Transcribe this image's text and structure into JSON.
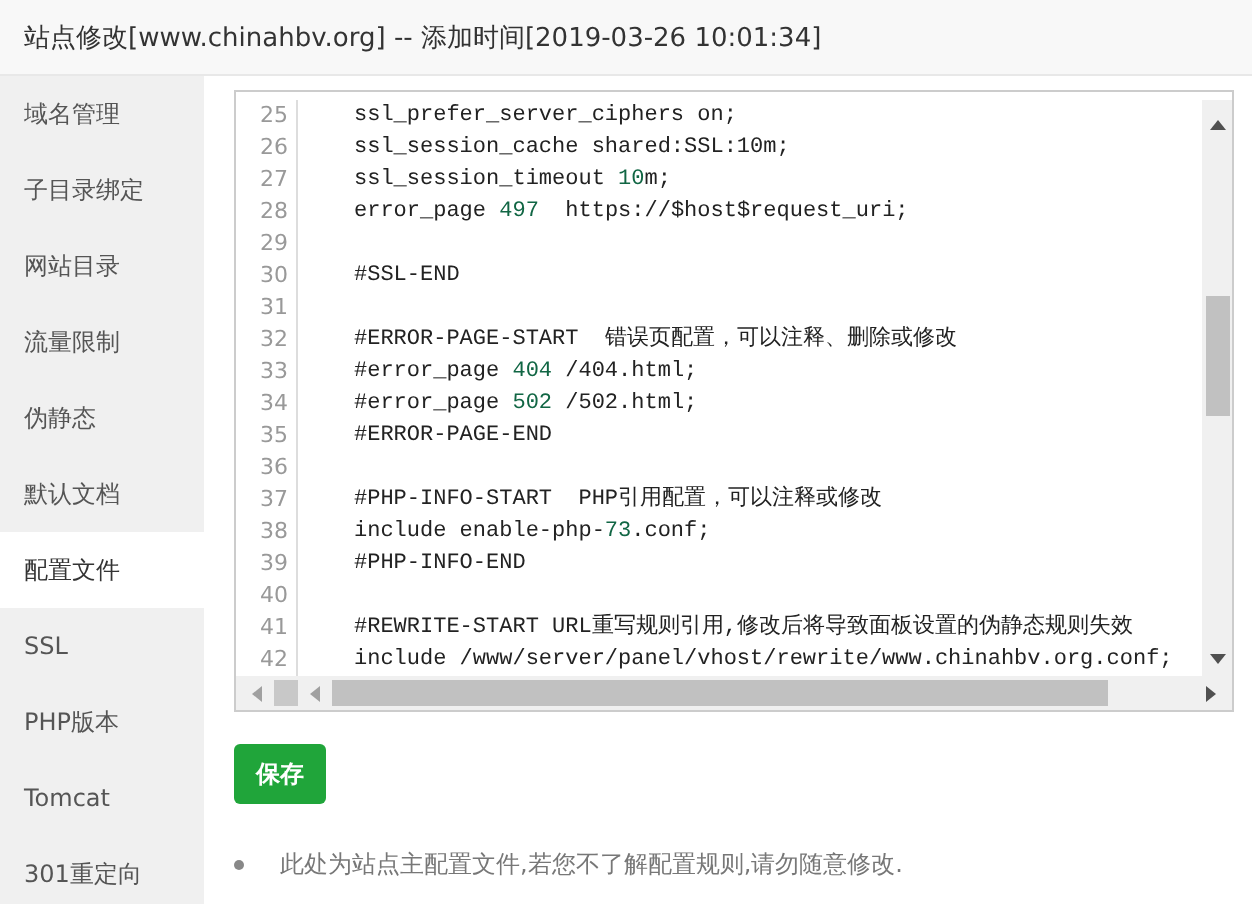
{
  "window": {
    "title": "站点修改[www.chinahbv.org] -- 添加时间[2019-03-26 10:01:34]"
  },
  "sidebar": {
    "items": [
      {
        "label": "域名管理",
        "selected": false
      },
      {
        "label": "子目录绑定",
        "selected": false
      },
      {
        "label": "网站目录",
        "selected": false
      },
      {
        "label": "流量限制",
        "selected": false
      },
      {
        "label": "伪静态",
        "selected": false
      },
      {
        "label": "默认文档",
        "selected": false
      },
      {
        "label": "配置文件",
        "selected": true
      },
      {
        "label": "SSL",
        "selected": false
      },
      {
        "label": "PHP版本",
        "selected": false
      },
      {
        "label": "Tomcat",
        "selected": false
      },
      {
        "label": "301重定向",
        "selected": false
      }
    ]
  },
  "editor": {
    "lines": [
      {
        "number": "25",
        "segments": [
          {
            "kind": "text",
            "text": "ssl_prefer_server_ciphers on;"
          }
        ]
      },
      {
        "number": "26",
        "segments": [
          {
            "kind": "text",
            "text": "ssl_session_cache shared:SSL:10m;"
          }
        ]
      },
      {
        "number": "27",
        "segments": [
          {
            "kind": "text",
            "text": "ssl_session_timeout "
          },
          {
            "kind": "number",
            "text": "10"
          },
          {
            "kind": "text",
            "text": "m;"
          }
        ]
      },
      {
        "number": "28",
        "segments": [
          {
            "kind": "text",
            "text": "error_page "
          },
          {
            "kind": "number",
            "text": "497"
          },
          {
            "kind": "text",
            "text": "  https://$host$request_uri;"
          }
        ]
      },
      {
        "number": "29"
      },
      {
        "number": "30",
        "segments": [
          {
            "kind": "text",
            "text": "#SSL-END"
          }
        ]
      },
      {
        "number": "31"
      },
      {
        "number": "32",
        "segments": [
          {
            "kind": "text",
            "text": "#ERROR-PAGE-START  错误页配置，可以注释、删除或修改"
          }
        ]
      },
      {
        "number": "33",
        "segments": [
          {
            "kind": "text",
            "text": "#error_page "
          },
          {
            "kind": "number",
            "text": "404"
          },
          {
            "kind": "text",
            "text": " /404.html;"
          }
        ]
      },
      {
        "number": "34",
        "segments": [
          {
            "kind": "text",
            "text": "#error_page "
          },
          {
            "kind": "number",
            "text": "502"
          },
          {
            "kind": "text",
            "text": " /502.html;"
          }
        ]
      },
      {
        "number": "35",
        "segments": [
          {
            "kind": "text",
            "text": "#ERROR-PAGE-END"
          }
        ]
      },
      {
        "number": "36"
      },
      {
        "number": "37",
        "segments": [
          {
            "kind": "text",
            "text": "#PHP-INFO-START  PHP引用配置，可以注释或修改"
          }
        ]
      },
      {
        "number": "38",
        "segments": [
          {
            "kind": "text",
            "text": "include enable-php-"
          },
          {
            "kind": "number",
            "text": "73"
          },
          {
            "kind": "text",
            "text": ".conf;"
          }
        ]
      },
      {
        "number": "39",
        "segments": [
          {
            "kind": "text",
            "text": "#PHP-INFO-END"
          }
        ]
      },
      {
        "number": "40"
      },
      {
        "number": "41",
        "segments": [
          {
            "kind": "text",
            "text": "#REWRITE-START URL重写规则引用,修改后将导致面板设置的伪静态规则失效"
          }
        ]
      },
      {
        "number": "42",
        "segments": [
          {
            "kind": "text",
            "text": "include /www/server/panel/vhost/rewrite/www.chinahbv.org.conf;"
          }
        ]
      }
    ]
  },
  "save_button": "保存",
  "notes": [
    "此处为站点主配置文件,若您不了解配置规则,请勿随意修改."
  ]
}
